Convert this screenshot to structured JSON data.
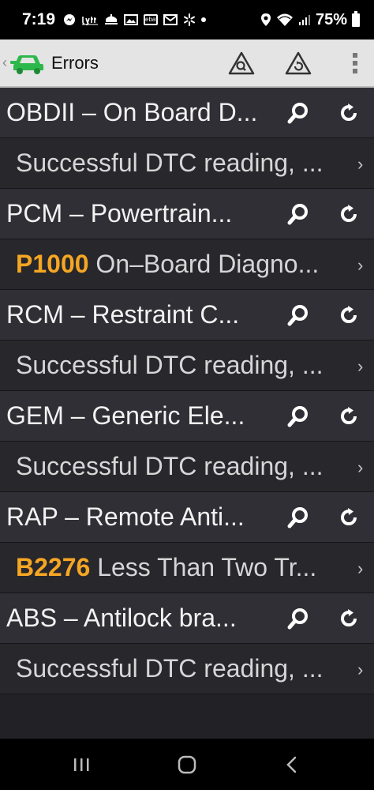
{
  "status_bar": {
    "time": "7:19",
    "battery": "75%",
    "icons": [
      "messenger-icon",
      "lyft-icon",
      "chef-hat-icon",
      "image-icon",
      "ebay-icon",
      "mail-icon",
      "walmart-icon",
      "dot-icon",
      "location-icon",
      "wifi-icon",
      "signal-icon",
      "battery-icon"
    ],
    "ebay_text": "ebay"
  },
  "toolbar": {
    "back_glyph": "‹",
    "title": "Errors"
  },
  "modules": [
    {
      "name": "OBDII – On Board D...",
      "dtc_code": "",
      "dtc_text": "Successful DTC reading, ..."
    },
    {
      "name": "PCM – Powertrain...",
      "dtc_code": "P1000",
      "dtc_text": " On–Board Diagno..."
    },
    {
      "name": "RCM – Restraint C...",
      "dtc_code": "",
      "dtc_text": "Successful DTC reading, ..."
    },
    {
      "name": "GEM – Generic Ele...",
      "dtc_code": "",
      "dtc_text": "Successful DTC reading, ..."
    },
    {
      "name": "RAP – Remote Anti...",
      "dtc_code": "B2276",
      "dtc_text": " Less Than Two Tr..."
    },
    {
      "name": "ABS – Antilock bra...",
      "dtc_code": "",
      "dtc_text": "Successful DTC reading, ..."
    }
  ],
  "colors": {
    "dtc_code": "#f5a623",
    "module_row": "#2f2f35",
    "dtc_row": "#27272c",
    "toolbar": "#e4e4e4",
    "app_icon_green": "#2db84b"
  },
  "nav": {
    "icons": [
      "recent-apps-icon",
      "home-icon",
      "back-icon"
    ]
  }
}
